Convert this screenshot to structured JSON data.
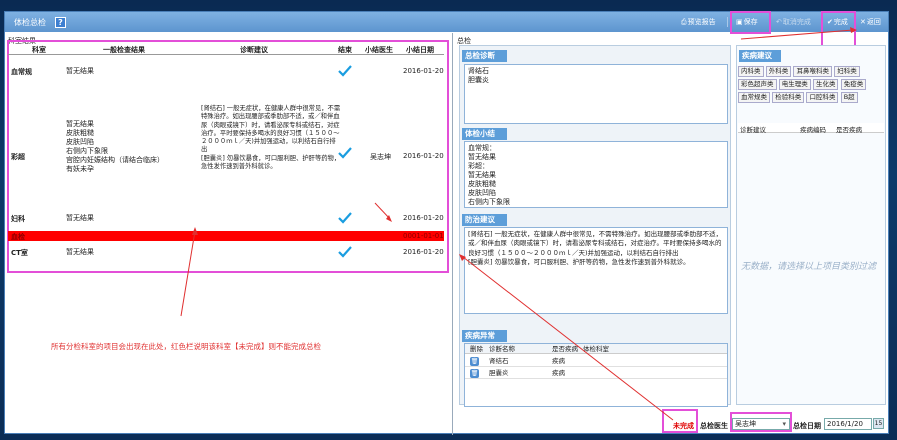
{
  "window": {
    "title": "体检总检",
    "help": "?"
  },
  "toolbar": {
    "preview_report": "预览报告",
    "save": "保存",
    "cancel_complete": "取消完成",
    "complete": "完成",
    "back": "返回"
  },
  "left": {
    "label": "科室结果",
    "headers": {
      "dept": "科室",
      "result": "一般检查结果",
      "diagnosis": "诊断建议",
      "end": "结束",
      "doctor": "小结医生",
      "date": "小结日期"
    },
    "rows": [
      {
        "dept": "血常规",
        "result": "暂无结果",
        "diagnosis": "",
        "doctor": "",
        "date": "2016-01-20"
      },
      {
        "dept": "彩超",
        "result": "暂无结果\n皮肤粗糙\n皮肤凹陷\n右侧内下象限\n宫腔内妊娠结构（请结合临床）\n有妖未孕",
        "diagnosis": "[肾结石] 一般无症状，在健康人群中很常见，不需特殊治疗。如出现腰部或季肋部不适，或／和伴血尿（肉眼或镜下）时，请看泌尿专科或结石，对症治疗。平时要保持多喝水的良好习惯（１５００～２０００ｍｌ／天)并加强运动，以利结石自行排出\n[胆囊炎] 勿暴饮暴食，可口服利胆、护肝等药物，急性发作速到普外科就诊。",
        "doctor": "吴志坤",
        "date": "2016-01-20"
      },
      {
        "dept": "妇科",
        "result": "暂无结果",
        "diagnosis": "",
        "doctor": "",
        "date": "2016-01-20"
      },
      {
        "dept": "血检",
        "result": "",
        "diagnosis": "",
        "doctor": "",
        "date": "0001-01-01"
      },
      {
        "dept": "CT室",
        "result": "暂无结果",
        "diagnosis": "",
        "doctor": "",
        "date": "2016-01-20"
      }
    ],
    "annotation": "所有分检科室的项目会出现在此处，红色栏说明该科室【未完成】则不能完成总检"
  },
  "right": {
    "label": "总检",
    "diagnosis_title": "总检诊断",
    "diagnosis_text": "肾结石\n胆囊炎",
    "summary_title": "体检小结",
    "summary_text": "血常规：\n暂无结果\n彩超：\n暂无结果\n皮肤粗糙\n皮肤凹陷\n右侧内下象限",
    "advice_title": "防治建议",
    "advice_text": "[肾结石] 一般无症状，在健康人群中很常见，不需特殊治疗。如出现腰部或季肋部不适，或／和伴血尿（肉眼或镜下）时，请看泌尿专科或结石，对症治疗。平时要保持多喝水的良好习惯（１５００～２０００ｍｌ／天)并加强运动，以利结石自行排出\n[胆囊炎] 勿暴饮暴食，可口服利胆、护肝等药物，急性发作速到普外科就诊。",
    "abnormal_title": "疾病异常",
    "abnormal_headers": {
      "delete": "删除",
      "name": "诊断名称",
      "is_disease": "是否疾病",
      "dept": "体检科室"
    },
    "abnormal_rows": [
      {
        "name": "肾结石",
        "is_disease": "疾病"
      },
      {
        "name": "胆囊炎",
        "is_disease": "疾病"
      }
    ],
    "disease_title": "疾病建议",
    "disease_tabs": [
      "内科类",
      "外科类",
      "耳鼻喉科类",
      "妇科类",
      "彩色超声类",
      "电生理类",
      "生化类",
      "免疫类",
      "血常规类",
      "检验科类",
      "口腔科类",
      "B超"
    ],
    "disease_headers": {
      "advice": "诊断建议",
      "code": "疾病编码",
      "is_disease": "是否疾病"
    },
    "no_data": "无数据，请选择以上项目类别过滤",
    "footer": {
      "status": "未完成",
      "doctor_label": "总检医生",
      "doctor_value": "吴志坤",
      "date_label": "总检日期",
      "date_value": "2016/1/20"
    }
  },
  "colors": {
    "accent": "#5d9ed9",
    "highlight": "#e34fd8",
    "incomplete": "#ff0000"
  }
}
